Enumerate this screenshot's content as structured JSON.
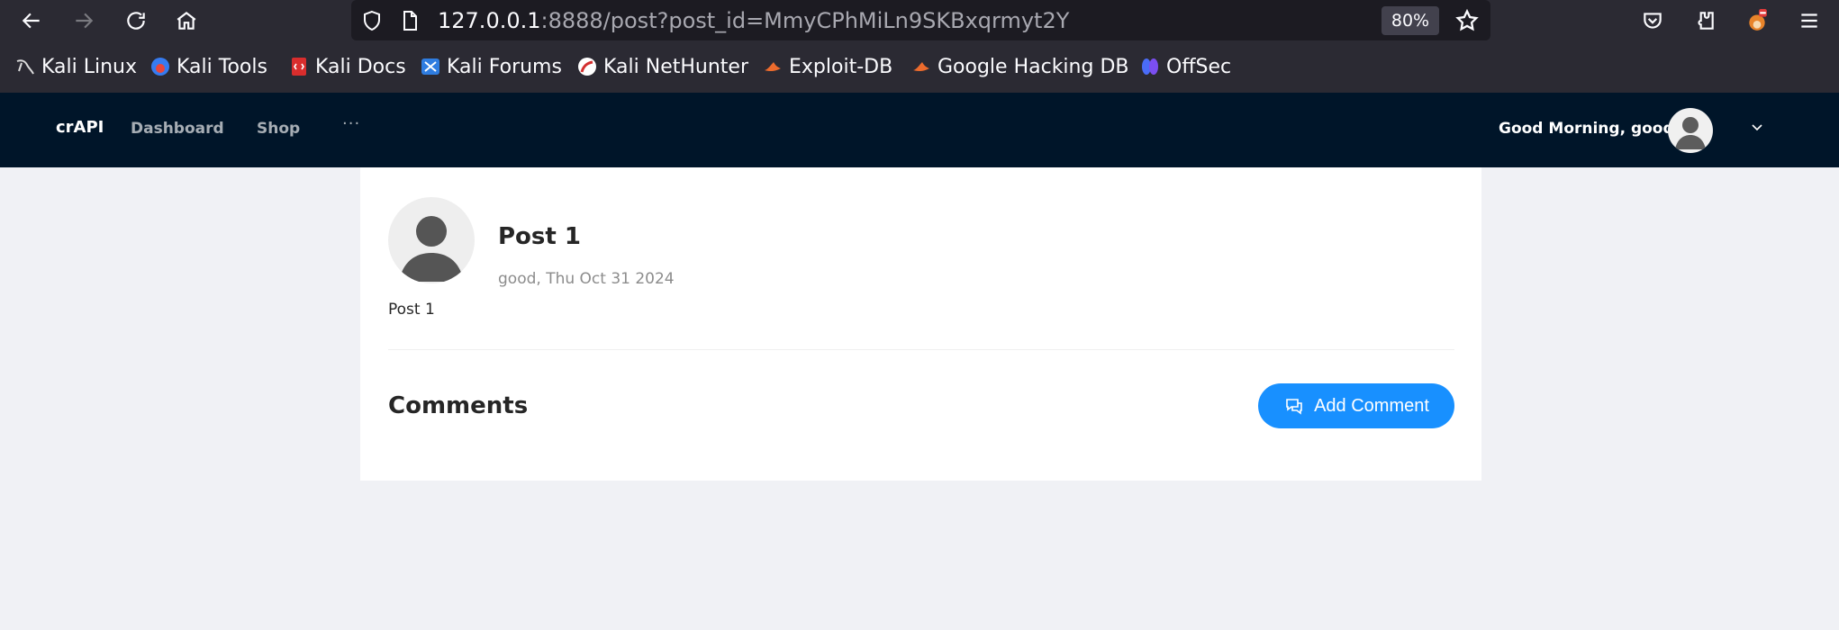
{
  "browser": {
    "url_host": "127.0.0.1",
    "url_rest": ":8888/post?post_id=MmyCPhMiLn9SKBxqrmyt2Y",
    "zoom": "80%",
    "bookmarks": [
      {
        "label": "Kali Linux",
        "icon": "kali-dragon-icon"
      },
      {
        "label": "Kali Tools",
        "icon": "kali-tools-icon"
      },
      {
        "label": "Kali Docs",
        "icon": "kali-docs-icon"
      },
      {
        "label": "Kali Forums",
        "icon": "kali-forums-icon"
      },
      {
        "label": "Kali NetHunter",
        "icon": "nethunter-icon"
      },
      {
        "label": "Exploit-DB",
        "icon": "exploit-db-icon"
      },
      {
        "label": "Google Hacking DB",
        "icon": "ghdb-icon"
      },
      {
        "label": "OffSec",
        "icon": "offsec-icon"
      }
    ]
  },
  "navbar": {
    "brand": "crAPI",
    "links": [
      "Dashboard",
      "Shop"
    ],
    "more": "···",
    "greeting": "Good Morning, good!"
  },
  "post": {
    "title": "Post 1",
    "meta": "good, Thu Oct 31 2024",
    "body": "Post 1"
  },
  "comments": {
    "title": "Comments",
    "add_button": "Add Comment"
  },
  "colors": {
    "navbar_bg": "#001529",
    "primary": "#1890ff",
    "page_bg": "#f0f1f5"
  }
}
